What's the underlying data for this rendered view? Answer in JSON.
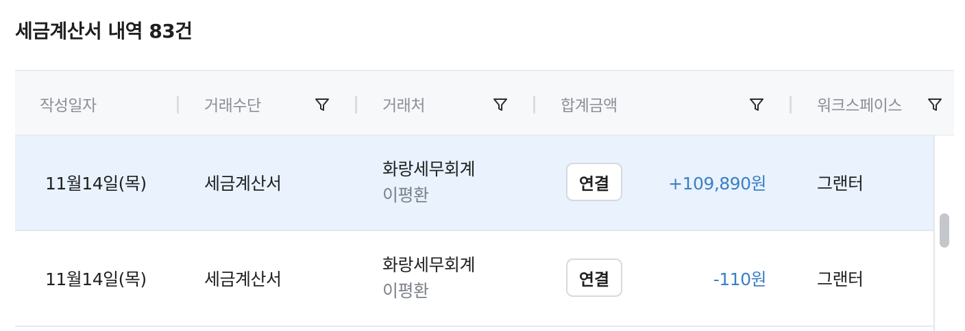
{
  "page": {
    "title": "세금계산서 내역 83건"
  },
  "table": {
    "columns": [
      {
        "label": "작성일자",
        "filterable": false
      },
      {
        "label": "거래수단",
        "filterable": true
      },
      {
        "label": "거래처",
        "filterable": true
      },
      {
        "label": "합계금액",
        "filterable": true
      },
      {
        "label": "워크스페이스",
        "filterable": true
      }
    ],
    "rows": [
      {
        "date": "11월14일(목)",
        "method": "세금계산서",
        "vendor_name": "화랑세무회계",
        "vendor_person": "이평환",
        "connect_label": "연결",
        "amount": "+109,890원",
        "workspace": "그랜터",
        "selected": true
      },
      {
        "date": "11월14일(목)",
        "method": "세금계산서",
        "vendor_name": "화랑세무회계",
        "vendor_person": "이평환",
        "connect_label": "연결",
        "amount": "-110원",
        "workspace": "그랜터",
        "selected": false
      }
    ]
  },
  "icons": {
    "filter": "filter-funnel-icon"
  },
  "colors": {
    "header_bg": "#f7f8fa",
    "selected_row_bg": "#e9f2fd",
    "amount_text": "#3b7fc4",
    "muted_text": "#8a8f96"
  }
}
